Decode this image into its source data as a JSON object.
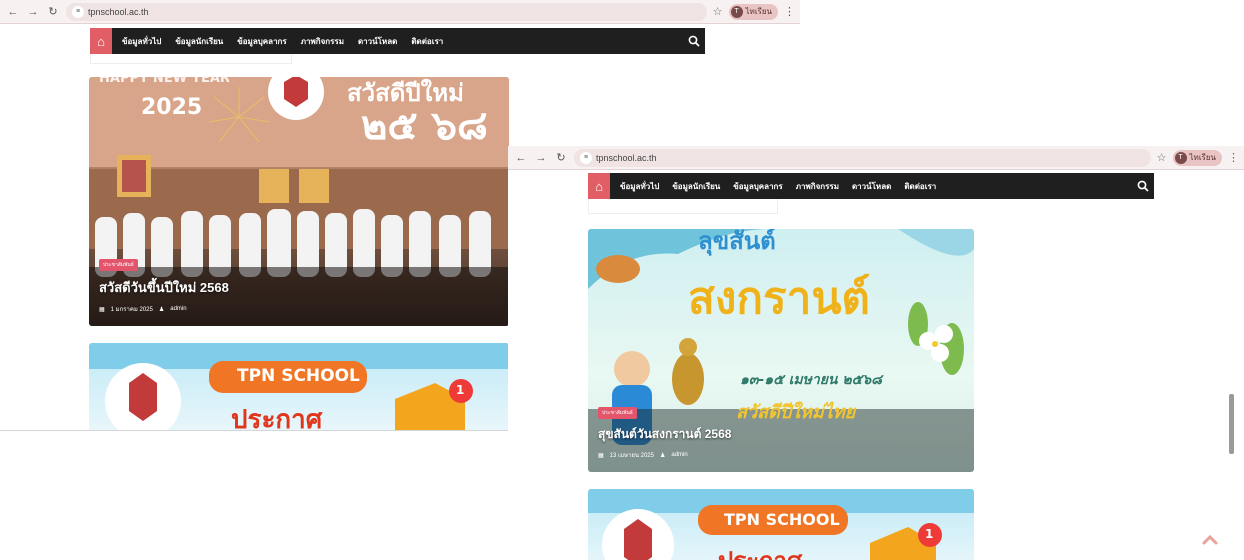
{
  "browser": {
    "url": "tpnschool.ac.th",
    "profile_name": "ไทเรียน",
    "profile_initial": "T"
  },
  "site": {
    "menu": [
      "ข้อมูลทั่วไป",
      "ข้อมูลนักเรียน",
      "ข้อมูลบุคลากร",
      "ภาพกิจกรรม",
      "ดาวน์โหลด",
      "ติดต่อเรา"
    ]
  },
  "post1": {
    "banner_line1": "HAPPY NEW YEAR",
    "banner_line2": "2025",
    "thai_banner": "สวัสดีปีใหม่",
    "thai_year": "๒๕ ๖๘",
    "category": "ประชาสัมพันธ์",
    "title": "สวัสดีวันขึ้นปีใหม่ 2568",
    "date": "1 มกราคม 2025",
    "author": "admin"
  },
  "post2": {
    "thai_banner": "สงกรานต์",
    "date_range": "๑๓-๑๕ เมษายน ๒๕๖๘",
    "subtitle": "สวัสดีปีใหม่ไทย",
    "category": "ประชาสัมพันธ์",
    "title": "สุขสันต์วันสงกรานต์ 2568",
    "date": "13 เมษายน 2025",
    "author": "admin"
  },
  "promo": {
    "label": "TPN SCHOOL",
    "thai": "ประกาศ",
    "badge_count": "1"
  },
  "colors": {
    "nav_bg": "#1f1f1f",
    "accent": "#e25e66",
    "chrome_bg": "#f7f1f1"
  }
}
